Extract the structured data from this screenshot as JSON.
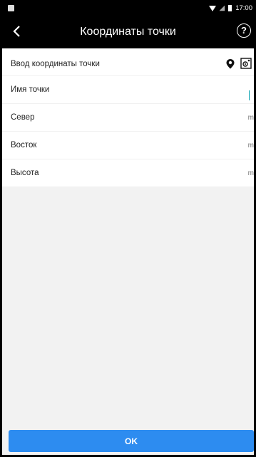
{
  "status": {
    "time": "17:00"
  },
  "header": {
    "title": "Координаты точки",
    "help_symbol": "?"
  },
  "form": {
    "section_title": "Ввод координаты точки",
    "rows": [
      {
        "label": "Имя точки",
        "unit": ""
      },
      {
        "label": "Север",
        "unit": "m"
      },
      {
        "label": "Восток",
        "unit": "m"
      },
      {
        "label": "Высота",
        "unit": "m"
      }
    ]
  },
  "actions": {
    "ok_label": "OK"
  },
  "colors": {
    "accent": "#2d8cf0",
    "cursor": "#00a0b0",
    "bar": "#000000"
  },
  "icons": [
    "back-arrow-icon",
    "help-icon",
    "location-pin-icon",
    "gps-target-icon",
    "wifi-icon",
    "no-signal-icon",
    "battery-icon",
    "gallery-icon"
  ]
}
